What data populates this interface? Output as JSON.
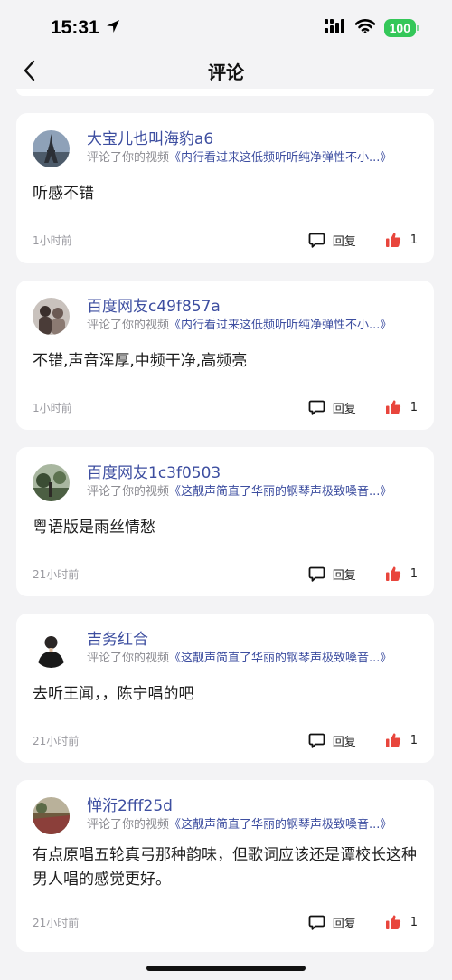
{
  "status": {
    "time": "15:31",
    "battery": "100"
  },
  "nav": {
    "title": "评论"
  },
  "comments": [
    {
      "username": "大宝儿也叫海豹a6",
      "prefix": "评论了你的视频",
      "video": "《内行看过来这低频听听纯净弹性不小...》",
      "content": "听感不错",
      "time_ago": "1小时前",
      "reply_label": "回复",
      "likes": "1",
      "avatar": "eiffel-tower-avatar"
    },
    {
      "username": "百度网友c49f857a",
      "prefix": "评论了你的视频",
      "video": "《内行看过来这低频听听纯净弹性不小...》",
      "content": "不错,声音浑厚,中频干净,高频亮",
      "time_ago": "1小时前",
      "reply_label": "回复",
      "likes": "1",
      "avatar": "people-photo-avatar"
    },
    {
      "username": "百度网友1c3f0503",
      "prefix": "评论了你的视频",
      "video": "《这靓声简直了华丽的钢琴声极致嗓音...》",
      "content": "粤语版是雨丝情愁",
      "time_ago": "21小时前",
      "reply_label": "回复",
      "likes": "1",
      "avatar": "landscape-photo-avatar"
    },
    {
      "username": "吉务红合",
      "prefix": "评论了你的视频",
      "video": "《这靓声简直了华丽的钢琴声极致嗓音...》",
      "content": "去听王闻，，陈宁唱的吧",
      "time_ago": "21小时前",
      "reply_label": "回复",
      "likes": "1",
      "avatar": "person-photo-avatar"
    },
    {
      "username": "惮洐2fff25d",
      "prefix": "评论了你的视频",
      "video": "《这靓声简直了华丽的钢琴声极致嗓音...》",
      "content": "有点原唱五轮真弓那种韵味，但歌词应该还是谭校长这种男人唱的感觉更好。",
      "time_ago": "21小时前",
      "reply_label": "回复",
      "likes": "1",
      "avatar": "field-photo-avatar"
    }
  ],
  "colors": {
    "username": "#3d4ea0",
    "like": "#e8453c",
    "battery": "#34c759",
    "background": "#f3f3f5"
  }
}
